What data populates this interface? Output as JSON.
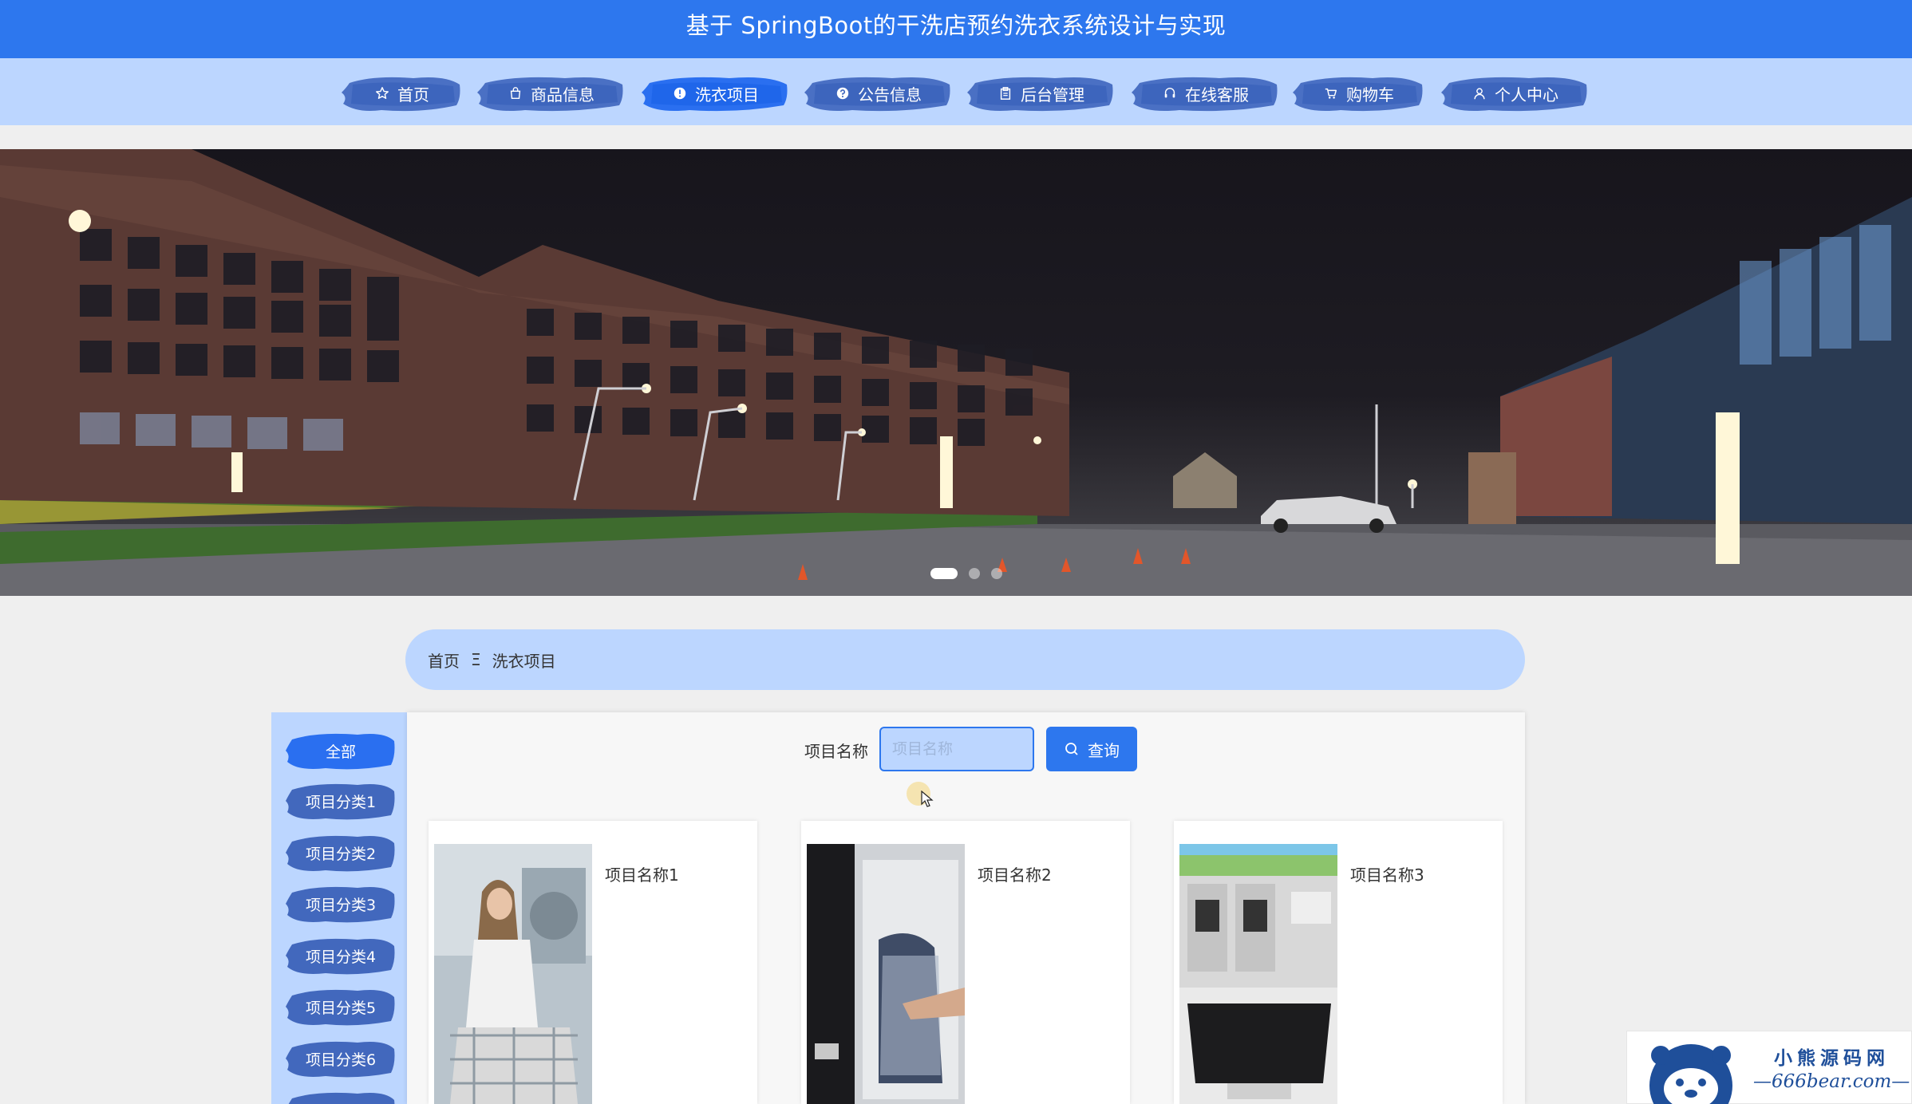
{
  "header": {
    "title": "基于 SpringBoot的干洗店预约洗衣系统设计与实现"
  },
  "nav": {
    "items": [
      {
        "label": "首页",
        "icon": "star-icon"
      },
      {
        "label": "商品信息",
        "icon": "bag-icon"
      },
      {
        "label": "洗衣项目",
        "icon": "info-circle-icon",
        "active": true
      },
      {
        "label": "公告信息",
        "icon": "question-circle-icon"
      },
      {
        "label": "后台管理",
        "icon": "clipboard-icon"
      },
      {
        "label": "在线客服",
        "icon": "headset-icon"
      },
      {
        "label": "购物车",
        "icon": "cart-icon"
      },
      {
        "label": "个人中心",
        "icon": "user-icon"
      }
    ]
  },
  "breadcrumb": {
    "home": "首页",
    "separator": "Ξ",
    "current": "洗衣项目"
  },
  "categories": [
    {
      "label": "全部",
      "active": true
    },
    {
      "label": "项目分类1"
    },
    {
      "label": "项目分类2"
    },
    {
      "label": "项目分类3"
    },
    {
      "label": "项目分类4"
    },
    {
      "label": "项目分类5"
    },
    {
      "label": "项目分类6"
    }
  ],
  "search": {
    "label": "项目名称",
    "placeholder": "项目名称",
    "value": "",
    "button": "查询"
  },
  "items": [
    {
      "name": "项目名称1"
    },
    {
      "name": "项目名称2"
    },
    {
      "name": "项目名称3"
    }
  ],
  "watermark": {
    "line1": "小熊源码网",
    "line2": "—666bear.com—"
  },
  "colors": {
    "primary": "#2d77ee",
    "light": "#bcd6ff",
    "brush_dark": "#3c6fd0",
    "active": "#1f6cf0"
  }
}
